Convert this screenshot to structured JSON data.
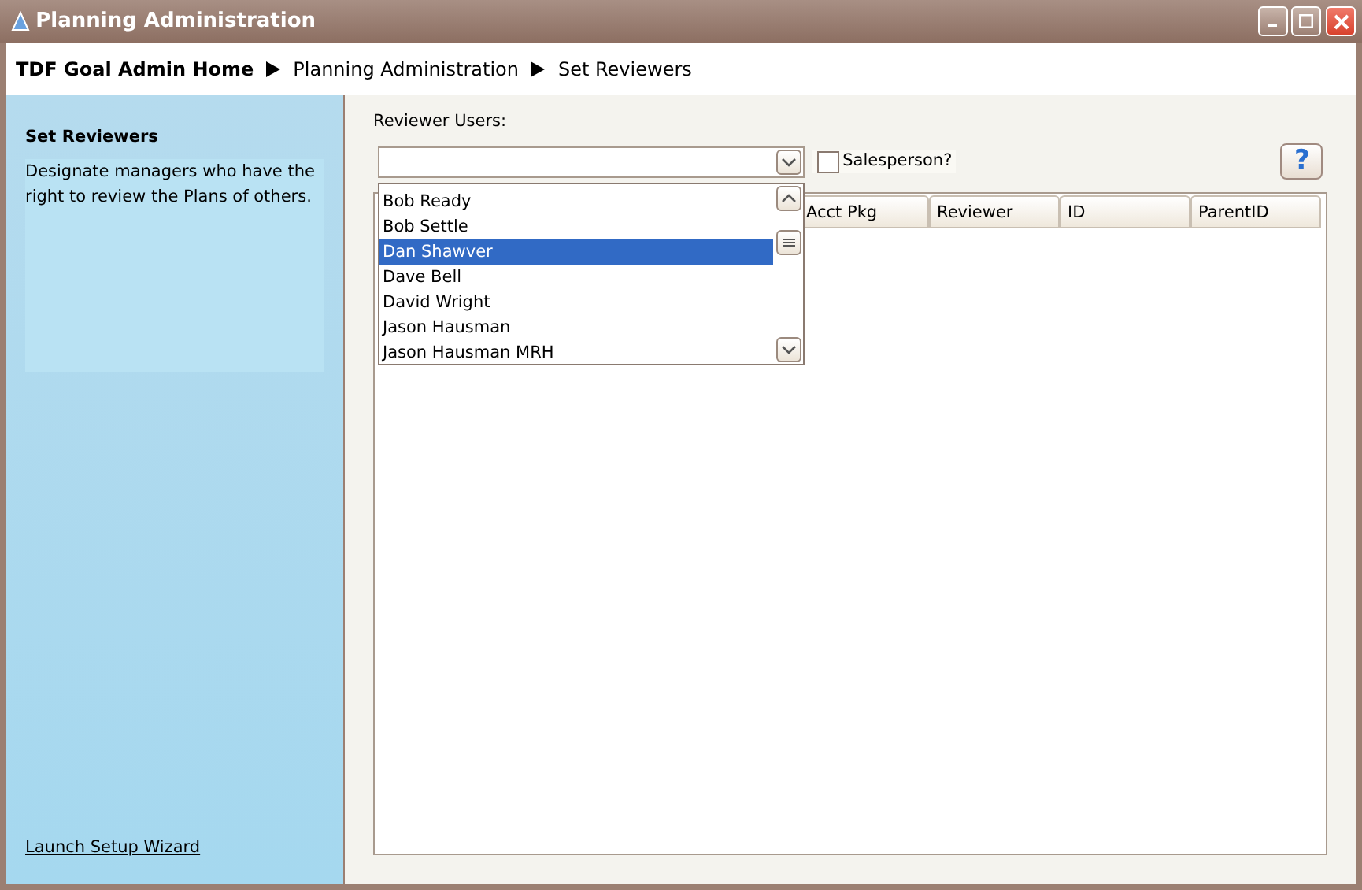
{
  "window": {
    "title": "Planning Administration"
  },
  "breadcrumb": [
    {
      "label": "TDF Goal Admin Home",
      "kind": "home"
    },
    {
      "label": "Planning Administration",
      "kind": "page"
    },
    {
      "label": "Set Reviewers",
      "kind": "page"
    }
  ],
  "sidebar": {
    "title": "Set Reviewers",
    "description": "Designate managers who have the right to review the Plans of others.",
    "link": "Launch Setup Wizard"
  },
  "reviewer_users": {
    "label": "Reviewer Users:",
    "expanded": true,
    "options": [
      {
        "label": "Bob Ready",
        "selected": false
      },
      {
        "label": "Bob Settle",
        "selected": false
      },
      {
        "label": "Dan Shawver",
        "selected": true
      },
      {
        "label": "Dave Bell",
        "selected": false
      },
      {
        "label": "David Wright",
        "selected": false
      },
      {
        "label": "Jason Hausman",
        "selected": false
      },
      {
        "label": "Jason Hausman MRH",
        "selected": false
      }
    ]
  },
  "salesperson": {
    "label": "Salesperson?",
    "checked": false
  },
  "help_button": {
    "label": "?"
  },
  "table": {
    "columns": [
      "Acct Pkg",
      "Reviewer",
      "ID",
      "ParentID"
    ]
  }
}
